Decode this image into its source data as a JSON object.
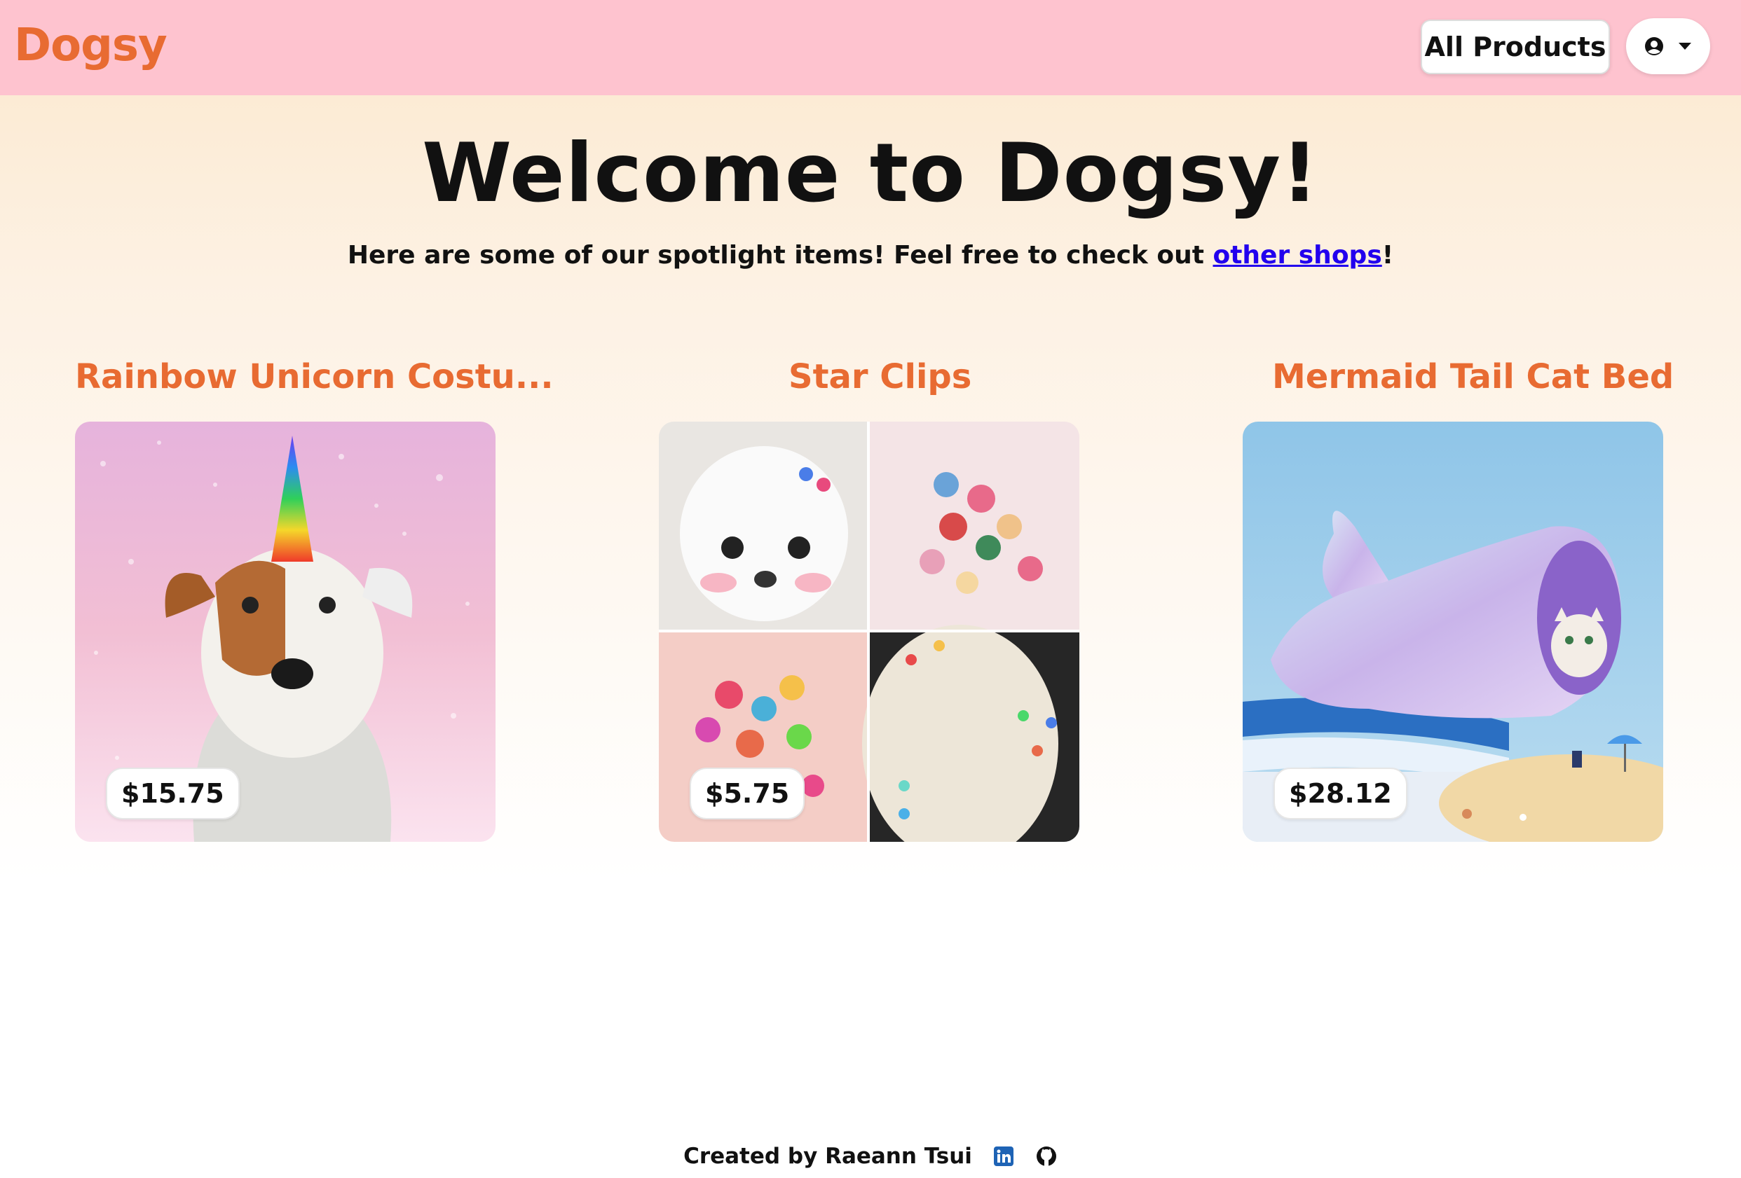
{
  "navbar": {
    "brand": "Dogsy",
    "all_products_label": "All Products",
    "user_menu_icon": "user-circle-icon"
  },
  "hero": {
    "title": "Welcome to Dogsy!",
    "subtitle_prefix": "Here are some of our spotlight items! Feel free to check out ",
    "subtitle_link": "other shops",
    "subtitle_suffix": "!"
  },
  "products": [
    {
      "title": "Rainbow Unicorn Costu...",
      "price": "$15.75",
      "image": "dog-with-rainbow-unicorn-horn"
    },
    {
      "title": "Star Clips",
      "price": "$5.75",
      "image": "star-hair-clips-collage"
    },
    {
      "title": "Mermaid Tail Cat Bed",
      "price": "$28.12",
      "image": "cat-in-mermaid-tail-bed"
    }
  ],
  "footer": {
    "credit": "Created by Raeann Tsui",
    "icons": [
      "linkedin-icon",
      "github-icon"
    ]
  },
  "colors": {
    "navbar_bg": "#fec3cf",
    "brand": "#e86b32",
    "link": "#2200ee"
  }
}
